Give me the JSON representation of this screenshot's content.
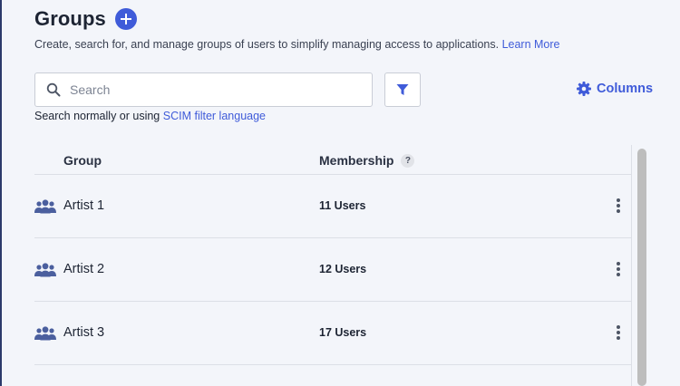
{
  "header": {
    "title": "Groups",
    "add_icon": "plus-circle-icon",
    "subtitle_text": "Create, search for, and manage groups of users to simplify managing access to applications.",
    "learn_more_label": "Learn More"
  },
  "search": {
    "placeholder": "Search",
    "value": "",
    "hint_prefix": "Search normally or using",
    "hint_link": "SCIM filter language"
  },
  "toolbar": {
    "columns_label": "Columns",
    "filter_icon": "filter-icon",
    "columns_icon": "gear-icon"
  },
  "table": {
    "columns": [
      "Group",
      "Membership"
    ],
    "membership_help": "?",
    "rows": [
      {
        "name": "Artist 1",
        "members": "11 Users"
      },
      {
        "name": "Artist 2",
        "members": "12 Users"
      },
      {
        "name": "Artist 3",
        "members": "17 Users"
      }
    ]
  },
  "colors": {
    "accent": "#3f5bd9",
    "background": "#f3f5fa",
    "text": "#1d2433",
    "group_icon": "#4b5f9e"
  }
}
